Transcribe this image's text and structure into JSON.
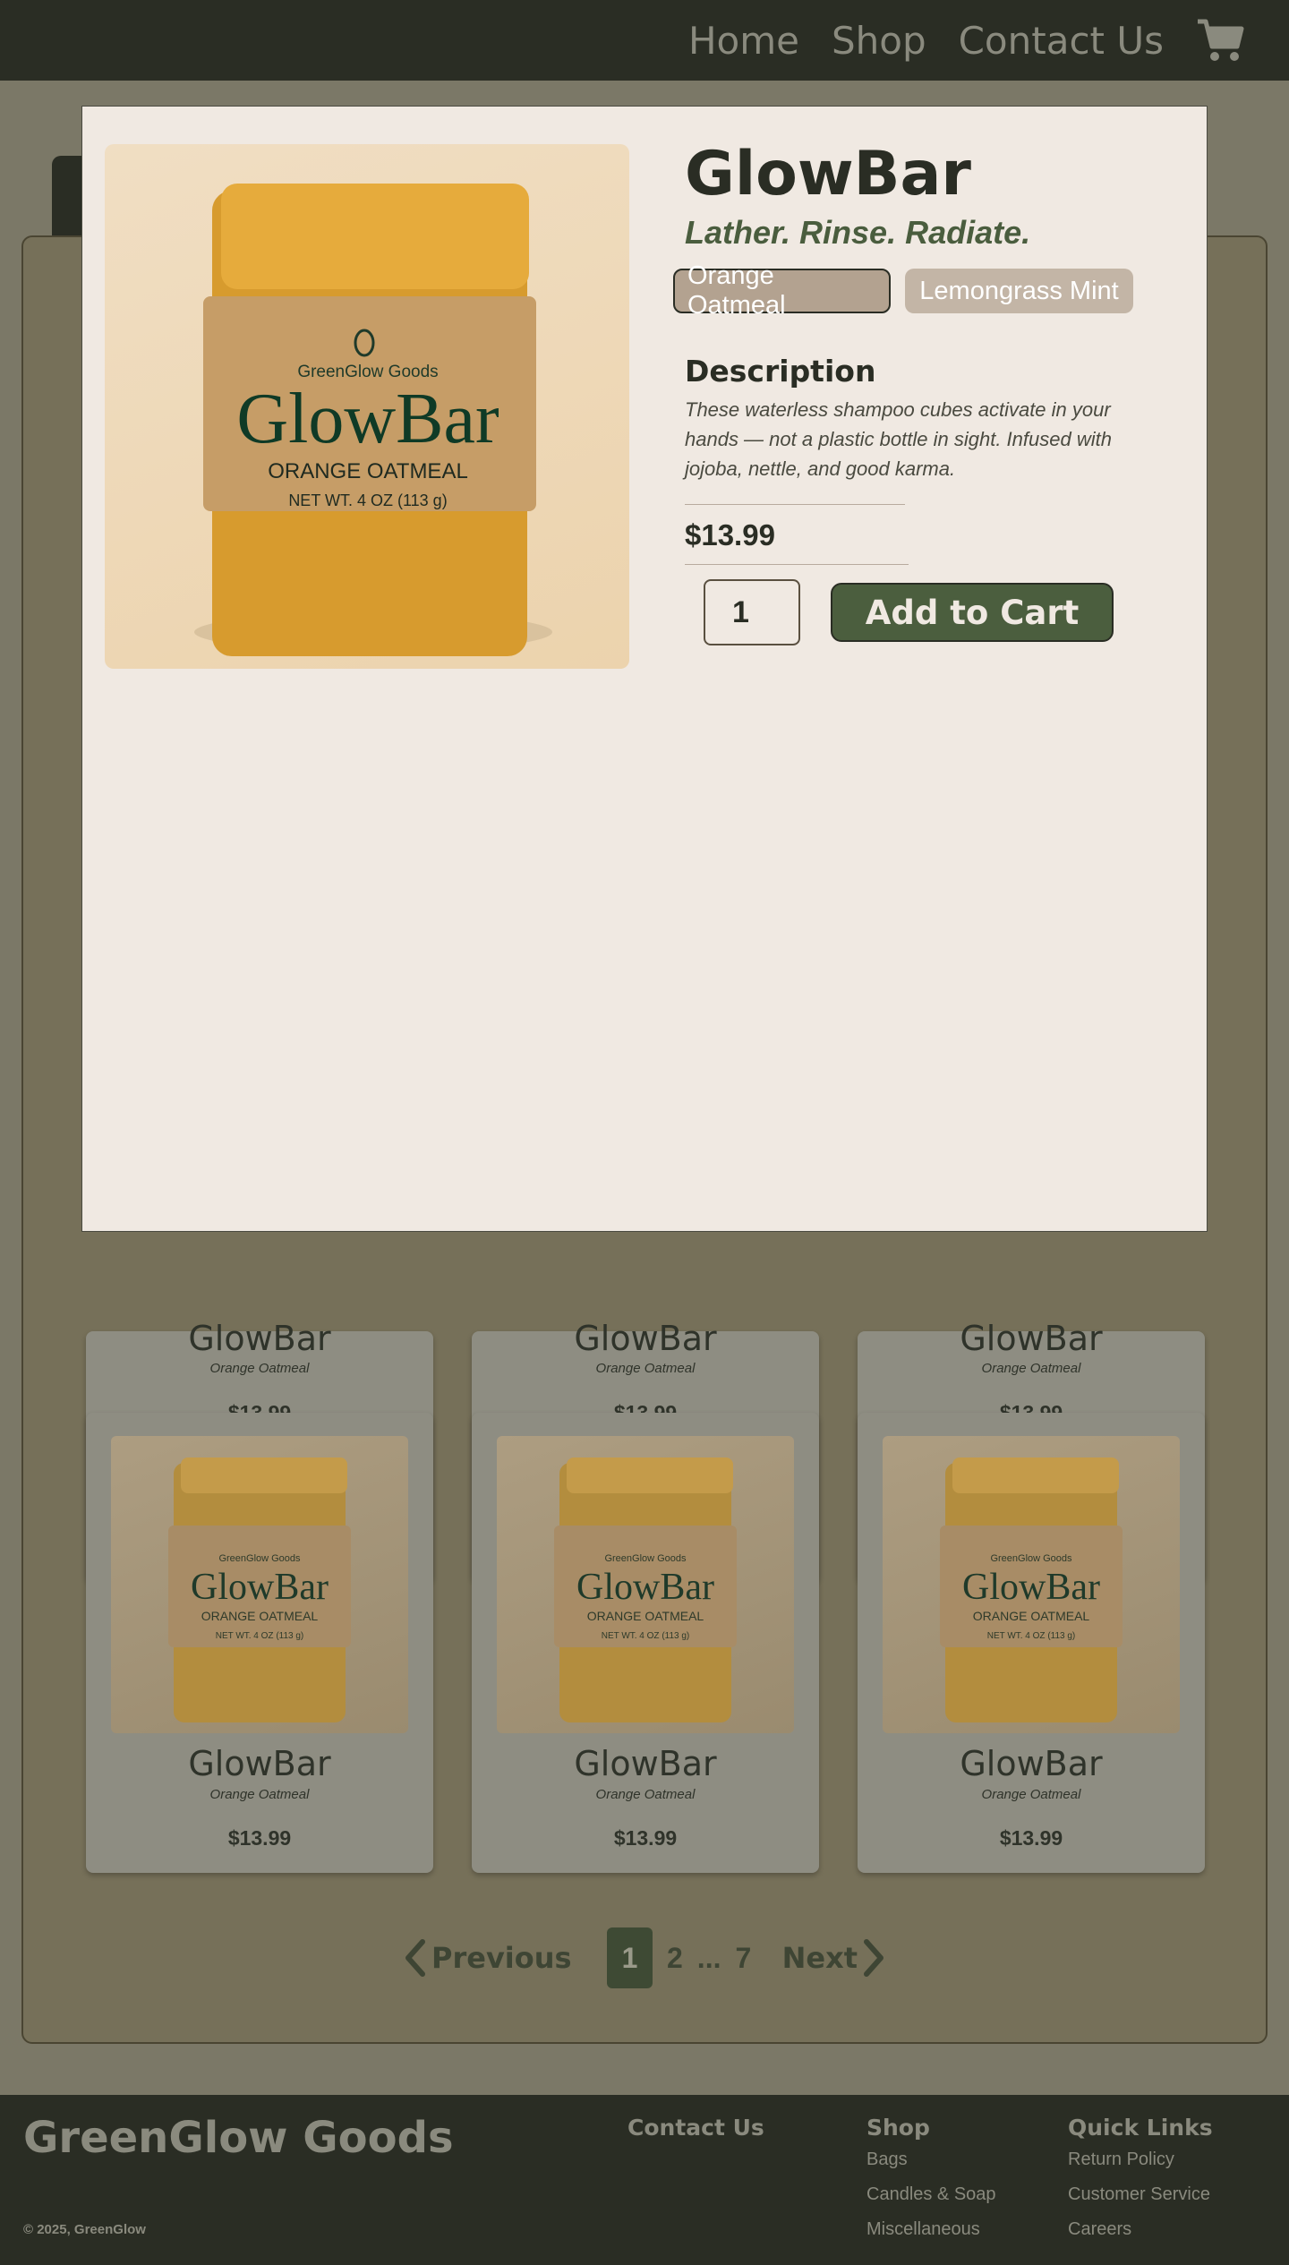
{
  "header": {
    "nav": [
      "Home",
      "Shop",
      "Contact Us"
    ],
    "cart_icon": "cart-icon"
  },
  "grid": {
    "cards_row1": [
      {
        "name": "GlowBar",
        "variant": "Orange Oatmeal",
        "price": "$13.99"
      },
      {
        "name": "GlowBar",
        "variant": "Orange Oatmeal",
        "price": "$13.99"
      },
      {
        "name": "GlowBar",
        "variant": "Orange Oatmeal",
        "price": "$13.99"
      }
    ],
    "cards_row2": [
      {
        "name": "GlowBar",
        "variant": "Orange Oatmeal",
        "price": "$13.99"
      },
      {
        "name": "GlowBar",
        "variant": "Orange Oatmeal",
        "price": "$13.99"
      },
      {
        "name": "GlowBar",
        "variant": "Orange Oatmeal",
        "price": "$13.99"
      }
    ],
    "product_label": {
      "brand": "GreenGlow Goods",
      "name": "GlowBar",
      "scent": "ORANGE OATMEAL",
      "weight": "NET WT. 4 OZ (113 g)"
    }
  },
  "pagination": {
    "prev": "Previous",
    "next": "Next",
    "pages": [
      "1",
      "2",
      "...",
      "7"
    ],
    "current": "1"
  },
  "footer": {
    "brand": "GreenGlow Goods",
    "copyright": "© 2025, GreenGlow",
    "contact_heading": "Contact Us",
    "shop_heading": "Shop",
    "shop_links": [
      "Bags",
      "Candles & Soap",
      "Miscellaneous"
    ],
    "quick_heading": "Quick Links",
    "quick_links": [
      "Return Policy",
      "Customer Service",
      "Careers"
    ]
  },
  "modal": {
    "title": "GlowBar",
    "tagline": "Lather. Rinse. Radiate.",
    "options": [
      "Orange Oatmeal",
      "Lemongrass Mint"
    ],
    "selected_option": "Orange Oatmeal",
    "description_heading": "Description",
    "description": "These waterless shampoo cubes activate in your hands — not a plastic bottle in sight. Infused with jojoba, nettle, and good karma.",
    "price": "$13.99",
    "quantity": "1",
    "add_to_cart": "Add to Cart"
  },
  "colors": {
    "dark": "#2a2d24",
    "accent_green": "#4b5e3e",
    "modal_bg": "#f0e9e2",
    "overlay": "#7b7867"
  }
}
